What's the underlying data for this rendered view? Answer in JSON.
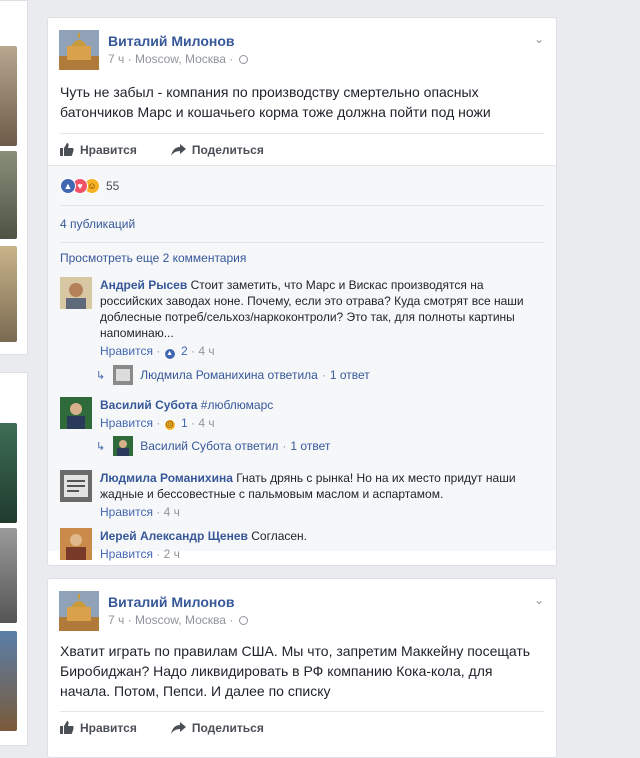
{
  "posts": [
    {
      "author": "Виталий Милонов",
      "time": "7 ч",
      "location": "Moscow, Москва",
      "separator": "·",
      "text": "Чуть не забыл - компания по производству смертельно опасных батончиков Марс и кошачьего корма тоже должна пойти под ножи",
      "like_label": "Нравится",
      "share_label": "Поделиться",
      "reaction_count": "55",
      "shares": "4 публикаций",
      "more_comments": "Просмотреть еще 2 комментария",
      "comments": [
        {
          "name": "Андрей Рысев",
          "text": "Стоит заметить, что Марс и Вискас производятся на российских заводах ноне. Почему, если это отрава? Куда смотрят все наши доблесные потреб/сельхоз/наркоконтроли? Это так, для полноты картины напоминаю...",
          "like": "Нравится",
          "count": "2",
          "time": "4 ч",
          "reply_text": "Людмила Романихина ответила",
          "reply_count": "1 ответ"
        },
        {
          "name": "Василий Субота",
          "text": "#люблюмарс",
          "like": "Нравится",
          "count": "1",
          "time": "4 ч",
          "reply_text": "Василий Субота ответил",
          "reply_count": "1 ответ"
        },
        {
          "name": "Людмила Романихина",
          "text": "Гнать дрянь с рынка! Но на их место придут наши жадные и бессовестные с пальмовым маслом и аспартамом.",
          "like": "Нравится",
          "time": "4 ч"
        },
        {
          "name": "Иерей Александр Щенев",
          "text": "Согласен.",
          "like": "Нравится",
          "time": "2 ч"
        }
      ]
    },
    {
      "author": "Виталий Милонов",
      "time": "7 ч",
      "location": "Moscow, Москва",
      "separator": "·",
      "text": "Хватит играть по правилам США. Мы что, запретим Маккейну посещать Биробиджан? Надо ликвидировать в РФ компанию Кока-кола, для начала. Потом, Пепси. И далее по списку",
      "like_label": "Нравится",
      "share_label": "Поделиться"
    }
  ],
  "colors": {
    "link": "#365899",
    "meta": "#90949c",
    "like_blue": "#4267b2",
    "love_red": "#f25268",
    "haha_yellow": "#f7b125"
  }
}
